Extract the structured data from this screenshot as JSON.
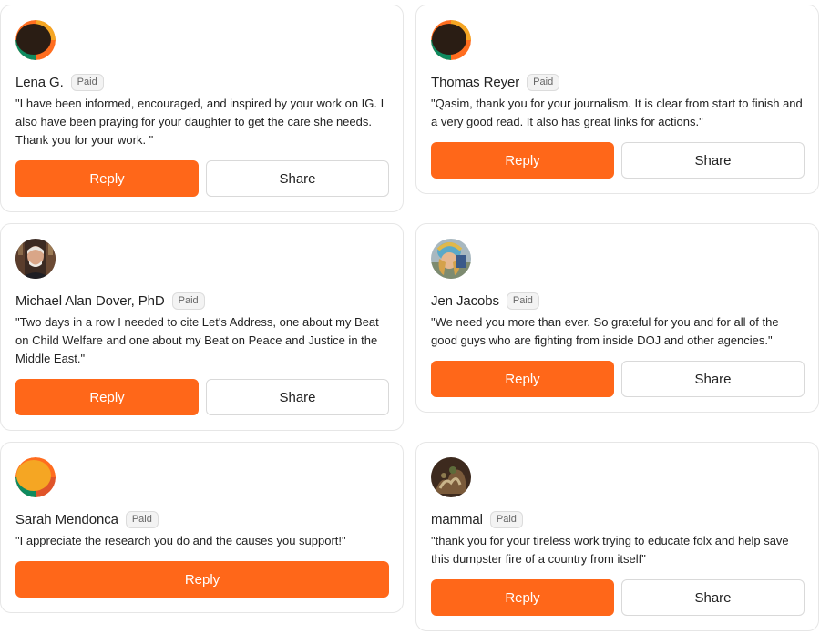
{
  "comments": [
    {
      "name": "Lena G.",
      "badge": "Paid",
      "text": "\"I have been informed, encouraged, and inspired by your work on IG. I also have been praying for your daughter to get the care she needs. Thank you for your work. \"",
      "reply_label": "Reply",
      "share_label": "Share",
      "avatar_icon": "orange-circle-avatar-icon"
    },
    {
      "name": "Thomas Reyer",
      "badge": "Paid",
      "text": "\"Qasim, thank you for your journalism. It is clear from start to finish and a very good read. It also has great links for actions.\"",
      "reply_label": "Reply",
      "share_label": "Share",
      "avatar_icon": "orange-circle-avatar-icon"
    },
    {
      "name": "Michael Alan Dover, PhD",
      "badge": "Paid",
      "text": "\"Two days in a row I needed to cite Let's Address, one about my Beat on Child Welfare and one about my Beat on Peace and Justice in the Middle East.\"",
      "reply_label": "Reply",
      "share_label": "Share",
      "avatar_icon": "photo-avatar-icon"
    },
    {
      "name": "Jen Jacobs",
      "badge": "Paid",
      "text": "\"We need you more than ever. So grateful for you and for all of the good guys who are fighting from inside DOJ and other agencies.\"",
      "reply_label": "Reply",
      "share_label": "Share",
      "avatar_icon": "photo-avatar-icon"
    },
    {
      "name": "Sarah Mendonca",
      "badge": "Paid",
      "text": "\"I appreciate the research you do and the causes you support!\"",
      "reply_label": "Reply",
      "avatar_icon": "yellow-circle-avatar-icon"
    },
    {
      "name": "mammal",
      "badge": "Paid",
      "text": "\"thank you for your tireless work trying to educate folx and help save this dumpster fire of a country from itself\"",
      "reply_label": "Reply",
      "share_label": "Share",
      "avatar_icon": "photo-avatar-icon"
    }
  ],
  "colors": {
    "accent": "#ff6719",
    "card_border": "#e6e6e6",
    "badge_bg": "#f3f3f3"
  }
}
